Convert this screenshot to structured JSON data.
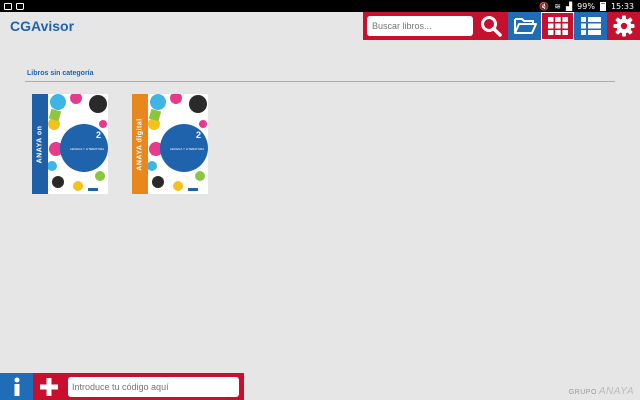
{
  "status_bar": {
    "battery": "99%",
    "time": "15:33"
  },
  "header": {
    "title": "CGAvisor"
  },
  "search": {
    "placeholder": "Buscar libros..."
  },
  "toolbar": {
    "buttons": [
      {
        "icon": "folder-open-icon",
        "color": "#1f6db6"
      },
      {
        "icon": "grid-view-icon",
        "color": "#c8102e"
      },
      {
        "icon": "list-view-icon",
        "color": "#1f6db6"
      },
      {
        "icon": "gear-icon",
        "color": "#c8102e"
      }
    ]
  },
  "section": {
    "title": "Libros sin categoría"
  },
  "books": [
    {
      "spine_label": "ANAYA on",
      "spine_color": "#1f5fa8",
      "cover_number": "2",
      "cover_subject": "LENGUA Y LITERATURA"
    },
    {
      "spine_label": "ANAYA digital",
      "spine_color": "#e8871e",
      "cover_number": "2",
      "cover_subject": "LENGUA Y LITERATURA"
    }
  ],
  "bottom": {
    "code_placeholder": "Introduce tu código aquí"
  },
  "brand": {
    "part1": "GRUPO",
    "part2": "ANAYA"
  },
  "colors": {
    "accent_blue": "#1f63ad",
    "accent_red": "#c8102e",
    "background": "#e6e6e6"
  }
}
